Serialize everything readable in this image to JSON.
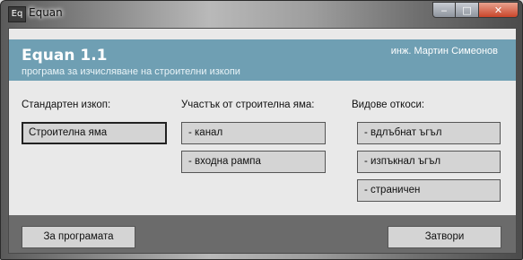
{
  "window": {
    "title": "Equan",
    "icon_text": "Eq",
    "controls": {
      "minimize": "‒",
      "maximize": "□",
      "close": "✕"
    }
  },
  "header": {
    "app_title": "Equan 1.1",
    "subtitle": "програма за изчисляване на строителни изкопи",
    "author": "инж. Мартин Симеонов"
  },
  "sections": {
    "standard": {
      "label": "Стандартен изкоп:",
      "buttons": [
        "Строителна яма"
      ]
    },
    "part": {
      "label": "Участък от строителна яма:",
      "buttons": [
        "- канал",
        "- входна рампа"
      ]
    },
    "slopes": {
      "label": "Видове откоси:",
      "buttons": [
        "- вдлъбнат ъгъл",
        "- изпъкнал ъгъл",
        "- страничен"
      ]
    }
  },
  "footer": {
    "about_label": "За програмата",
    "close_label": "Затвори"
  },
  "colors": {
    "header_bg": "#6f9fb3",
    "footer_bg": "#6b6b6b",
    "button_bg": "#d4d4d4",
    "client_bg": "#e9e9e9"
  }
}
